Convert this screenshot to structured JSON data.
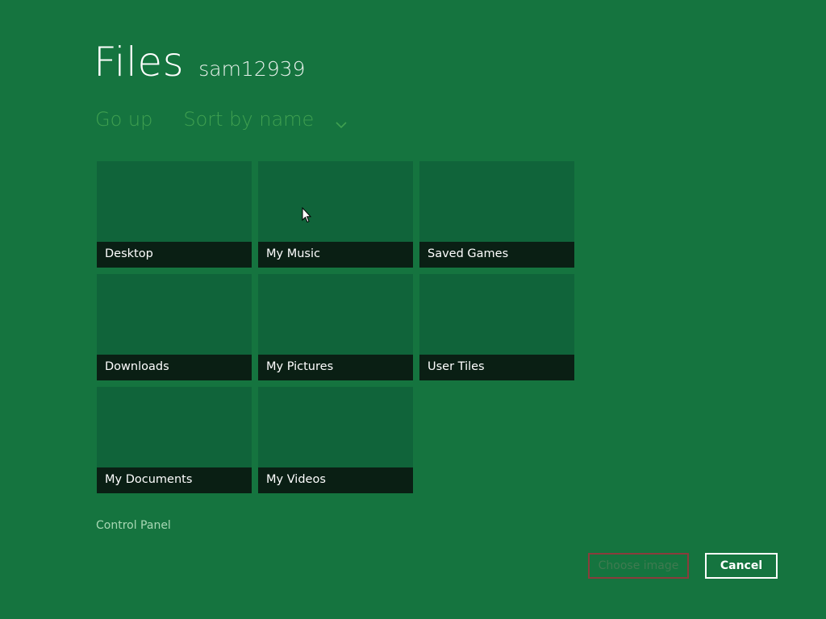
{
  "header": {
    "title": "Files",
    "subtitle": "sam12939"
  },
  "nav": {
    "go_up_label": "Go up",
    "sort_label": "Sort by name",
    "sort_icon": "chevron-down-icon"
  },
  "tiles": [
    {
      "label": "Desktop"
    },
    {
      "label": "My Music"
    },
    {
      "label": "Saved Games"
    },
    {
      "label": "Downloads"
    },
    {
      "label": "My Pictures"
    },
    {
      "label": "User Tiles"
    },
    {
      "label": "My Documents"
    },
    {
      "label": "My Videos"
    }
  ],
  "footer": {
    "control_panel_label": "Control Panel",
    "choose_image_label": "Choose image",
    "cancel_label": "Cancel"
  },
  "colors": {
    "background": "#15743f",
    "tile": "#10643a",
    "tile_label_bg": "#0a1f14",
    "nav_text": "#3fa050",
    "disabled_button_border": "#8a3c3c"
  },
  "cursor_icon": "mouse-pointer-icon"
}
